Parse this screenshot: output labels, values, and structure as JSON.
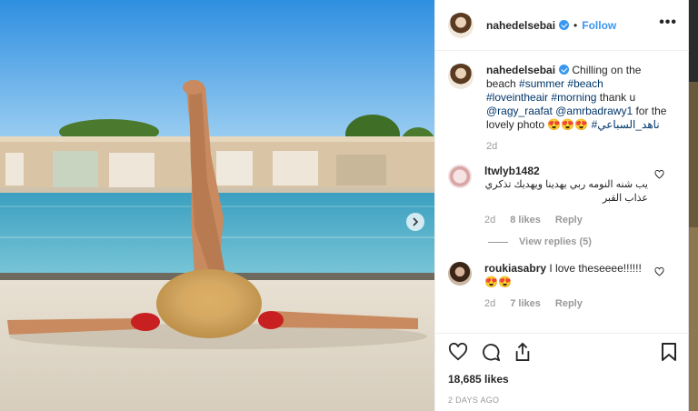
{
  "post": {
    "username": "nahedelsebai",
    "dot": "•",
    "follow_label": "Follow",
    "more_label": "•••"
  },
  "caption": {
    "username": "nahedelsebai",
    "text_1": " Chilling on the beach ",
    "tag_summer": "#summer",
    "tag_beach": "#beach",
    "tag_loveintheair": "#loveintheair",
    "tag_morning": "#morning",
    "text_2": " thank u ",
    "mention_1": "@ragy_raafat",
    "mention_2": "@amrbadrawy1",
    "text_3": " for the lovely photo ",
    "emoji": "😍😍😍",
    "tag_arabic": "#ناهد_السباعي",
    "time": "2d"
  },
  "comments": [
    {
      "username": "ltwlyb1482",
      "text": "يب شنه النومه ربي يهدينا ويهديك تذكري عذاب القبر",
      "time": "2d",
      "likes": "8 likes",
      "reply_label": "Reply",
      "view_replies": "View replies (5)"
    },
    {
      "username": "roukiasabry",
      "text": " I love theseeee!!!!!!😍😍",
      "time": "2d",
      "likes": "7 likes",
      "reply_label": "Reply"
    }
  ],
  "footer": {
    "likes": "18,685 likes",
    "date": "2 DAYS AGO"
  },
  "icons": {
    "like": "heart-icon",
    "comment": "comment-icon",
    "share": "share-icon",
    "save": "bookmark-icon",
    "next": "chevron-right-icon"
  },
  "colors": {
    "link": "#3897f0",
    "hashtag": "#003569",
    "muted": "#999999"
  }
}
